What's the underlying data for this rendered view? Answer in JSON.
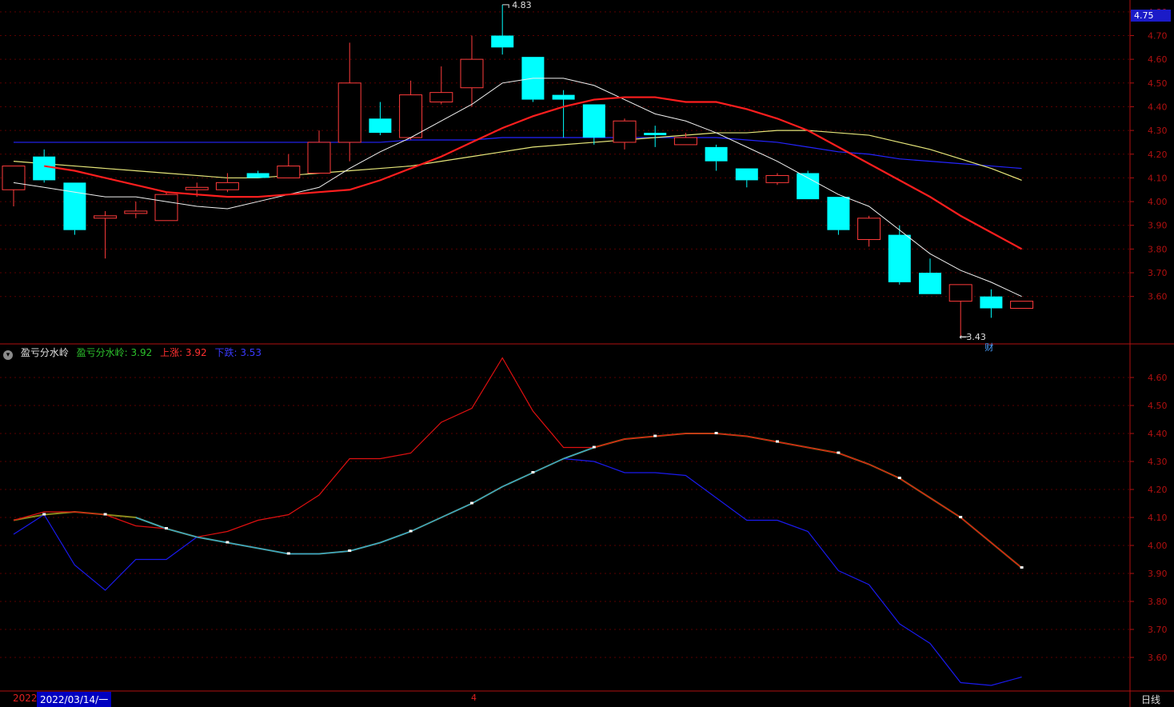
{
  "current_price_tag": "4.75",
  "period_label": "日线",
  "date_label": "2022/03/14/一",
  "year_label": "2022",
  "month_label": "4",
  "colors": {
    "up": "#ff3b3b",
    "down": "#00ffff",
    "ma_white": "#f0f0f0",
    "ma_red": "#ff1e1e",
    "ma_yellow": "#e6e67a",
    "ma_blue": "#2424ff",
    "axis": "#b01010",
    "grid": "#5a0000"
  },
  "indicator": {
    "name": "盈亏分水岭",
    "line_label": "盈亏分水岭: 3.92",
    "up_label": "上涨: 3.92",
    "down_label": "下跌: 3.53"
  },
  "chart_data": [
    {
      "type": "candlestick",
      "yaxis_ticks": [
        "3.60",
        "3.70",
        "3.80",
        "3.90",
        "4.00",
        "4.10",
        "4.20",
        "4.30",
        "4.40",
        "4.50",
        "4.60",
        "4.70",
        "4.80"
      ],
      "ylim": [
        3.4,
        4.85
      ],
      "high_annotation": "4.83",
      "low_annotation": "3.43",
      "event_marker": "财",
      "candles": [
        {
          "o": 4.05,
          "h": 4.15,
          "l": 3.98,
          "c": 4.15
        },
        {
          "o": 4.19,
          "h": 4.22,
          "l": 4.08,
          "c": 4.09
        },
        {
          "o": 4.08,
          "h": 4.08,
          "l": 3.86,
          "c": 3.88
        },
        {
          "o": 3.93,
          "h": 3.96,
          "l": 3.76,
          "c": 3.94
        },
        {
          "o": 3.95,
          "h": 4.0,
          "l": 3.93,
          "c": 3.96
        },
        {
          "o": 3.92,
          "h": 4.04,
          "l": 3.92,
          "c": 4.03
        },
        {
          "o": 4.05,
          "h": 4.08,
          "l": 4.02,
          "c": 4.06
        },
        {
          "o": 4.05,
          "h": 4.12,
          "l": 4.04,
          "c": 4.08
        },
        {
          "o": 4.12,
          "h": 4.13,
          "l": 4.1,
          "c": 4.1
        },
        {
          "o": 4.1,
          "h": 4.2,
          "l": 4.1,
          "c": 4.15
        },
        {
          "o": 4.12,
          "h": 4.3,
          "l": 4.12,
          "c": 4.25
        },
        {
          "o": 4.25,
          "h": 4.67,
          "l": 4.17,
          "c": 4.5
        },
        {
          "o": 4.35,
          "h": 4.42,
          "l": 4.28,
          "c": 4.29
        },
        {
          "o": 4.27,
          "h": 4.51,
          "l": 4.26,
          "c": 4.45
        },
        {
          "o": 4.42,
          "h": 4.57,
          "l": 4.41,
          "c": 4.46
        },
        {
          "o": 4.48,
          "h": 4.7,
          "l": 4.4,
          "c": 4.6
        },
        {
          "o": 4.7,
          "h": 4.83,
          "l": 4.62,
          "c": 4.65
        },
        {
          "o": 4.61,
          "h": 4.61,
          "l": 4.42,
          "c": 4.43
        },
        {
          "o": 4.45,
          "h": 4.47,
          "l": 4.27,
          "c": 4.43
        },
        {
          "o": 4.41,
          "h": 4.41,
          "l": 4.24,
          "c": 4.27
        },
        {
          "o": 4.25,
          "h": 4.35,
          "l": 4.22,
          "c": 4.34
        },
        {
          "o": 4.29,
          "h": 4.32,
          "l": 4.23,
          "c": 4.28
        },
        {
          "o": 4.24,
          "h": 4.29,
          "l": 4.24,
          "c": 4.27
        },
        {
          "o": 4.23,
          "h": 4.24,
          "l": 4.13,
          "c": 4.17
        },
        {
          "o": 4.14,
          "h": 4.14,
          "l": 4.06,
          "c": 4.09
        },
        {
          "o": 4.08,
          "h": 4.12,
          "l": 4.07,
          "c": 4.11
        },
        {
          "o": 4.12,
          "h": 4.13,
          "l": 4.01,
          "c": 4.01
        },
        {
          "o": 4.02,
          "h": 4.02,
          "l": 3.86,
          "c": 3.88
        },
        {
          "o": 3.84,
          "h": 3.94,
          "l": 3.81,
          "c": 3.93
        },
        {
          "o": 3.86,
          "h": 3.9,
          "l": 3.65,
          "c": 3.66
        },
        {
          "o": 3.7,
          "h": 3.76,
          "l": 3.61,
          "c": 3.61
        },
        {
          "o": 3.58,
          "h": 3.65,
          "l": 3.43,
          "c": 3.65
        },
        {
          "o": 3.6,
          "h": 3.63,
          "l": 3.51,
          "c": 3.55
        },
        {
          "o": 3.55,
          "h": 3.58,
          "l": 3.55,
          "c": 3.58
        }
      ],
      "ma_white": [
        4.08,
        4.06,
        4.04,
        4.02,
        4.02,
        4.0,
        3.98,
        3.97,
        4.0,
        4.03,
        4.06,
        4.14,
        4.21,
        4.27,
        4.34,
        4.41,
        4.5,
        4.52,
        4.52,
        4.49,
        4.43,
        4.37,
        4.34,
        4.29,
        4.23,
        4.17,
        4.1,
        4.03,
        3.98,
        3.88,
        3.78,
        3.71,
        3.66,
        3.6
      ],
      "ma_red": [
        4.15,
        4.13,
        4.1,
        4.07,
        4.04,
        4.03,
        4.02,
        4.02,
        4.03,
        4.04,
        4.05,
        4.09,
        4.14,
        4.19,
        4.25,
        4.31,
        4.36,
        4.4,
        4.43,
        4.44,
        4.44,
        4.42,
        4.42,
        4.39,
        4.35,
        4.3,
        4.23,
        4.16,
        4.09,
        4.02,
        3.94,
        3.87,
        3.8
      ],
      "ma_yellow": [
        4.17,
        4.16,
        4.15,
        4.14,
        4.13,
        4.12,
        4.11,
        4.1,
        4.1,
        4.11,
        4.12,
        4.13,
        4.14,
        4.15,
        4.17,
        4.19,
        4.21,
        4.23,
        4.24,
        4.25,
        4.26,
        4.27,
        4.28,
        4.29,
        4.29,
        4.3,
        4.3,
        4.29,
        4.28,
        4.25,
        4.22,
        4.18,
        4.14,
        4.09
      ],
      "ma_blue": [
        4.25,
        4.25,
        4.25,
        4.25,
        4.25,
        4.25,
        4.25,
        4.25,
        4.25,
        4.25,
        4.25,
        4.25,
        4.25,
        4.26,
        4.26,
        4.26,
        4.27,
        4.27,
        4.27,
        4.27,
        4.27,
        4.27,
        4.27,
        4.27,
        4.26,
        4.25,
        4.23,
        4.21,
        4.2,
        4.18,
        4.17,
        4.16,
        4.15,
        4.14
      ]
    },
    {
      "type": "line",
      "title": "盈亏分水岭",
      "yaxis_ticks": [
        "3.60",
        "3.70",
        "3.80",
        "3.90",
        "4.00",
        "4.10",
        "4.20",
        "4.30",
        "4.40",
        "4.50",
        "4.60"
      ],
      "ylim": [
        3.48,
        4.72
      ],
      "series": [
        {
          "name": "盈亏分水岭",
          "color": "#8a8a1e",
          "values": [
            4.09,
            4.11,
            4.12,
            4.11,
            4.1,
            4.06,
            4.03,
            4.01,
            3.99,
            3.97,
            3.97,
            3.98,
            4.01,
            4.05,
            4.1,
            4.15,
            4.21,
            4.26,
            4.31,
            4.35,
            4.38,
            4.39,
            4.4,
            4.4,
            4.39,
            4.37,
            4.35,
            4.33,
            4.29,
            4.24,
            4.17,
            4.1,
            4.01,
            3.92
          ]
        },
        {
          "name": "上涨",
          "color": "#e01010",
          "values": [
            4.09,
            4.12,
            4.12,
            4.11,
            4.07,
            4.06,
            4.03,
            4.05,
            4.09,
            4.11,
            4.18,
            4.31,
            4.31,
            4.33,
            4.44,
            4.49,
            4.67,
            4.48,
            4.35,
            4.35,
            4.38,
            4.39,
            4.4,
            4.4,
            4.39,
            4.37,
            4.35,
            4.33,
            4.29,
            4.24,
            4.17,
            4.1,
            4.01,
            3.92
          ]
        },
        {
          "name": "下跌",
          "color": "#1a1aee",
          "values": [
            4.04,
            4.11,
            3.93,
            3.84,
            3.95,
            3.95,
            4.03,
            4.01,
            3.99,
            3.97,
            3.97,
            3.98,
            4.01,
            4.05,
            4.1,
            4.15,
            4.21,
            4.26,
            4.31,
            4.3,
            4.26,
            4.26,
            4.25,
            4.17,
            4.09,
            4.09,
            4.05,
            3.91,
            3.86,
            3.72,
            3.65,
            3.51,
            3.5,
            3.53
          ]
        }
      ]
    }
  ]
}
